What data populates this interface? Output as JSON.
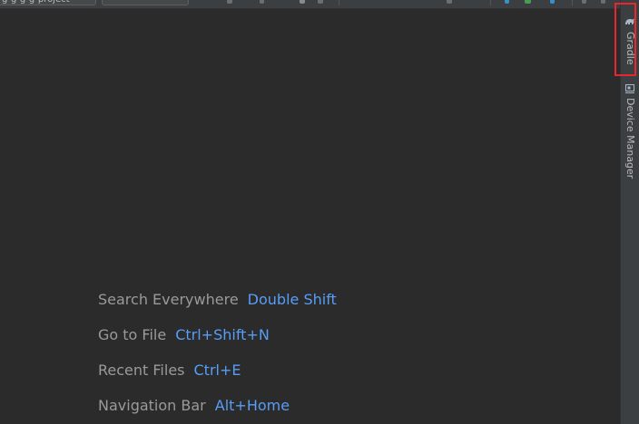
{
  "toolbar": {
    "project_selector_value": "g-g-g-g-project",
    "run_config_value": ""
  },
  "welcome_hints": [
    {
      "label": "Search Everywhere",
      "key": "Double Shift"
    },
    {
      "label": "Go to File",
      "key": "Ctrl+Shift+N"
    },
    {
      "label": "Recent Files",
      "key": "Ctrl+E"
    },
    {
      "label": "Navigation Bar",
      "key": "Alt+Home"
    }
  ],
  "right_stripe": {
    "gradle": {
      "label": "Gradle",
      "icon": "gradle-elephant-icon"
    },
    "device_manager": {
      "label": "Device Manager",
      "icon": "device-manager-icon"
    }
  },
  "colors": {
    "editor_bg": "#2b2b2b",
    "hint_label": "#9a9a9a",
    "hint_key": "#589df6",
    "highlight": "#e8262f"
  }
}
